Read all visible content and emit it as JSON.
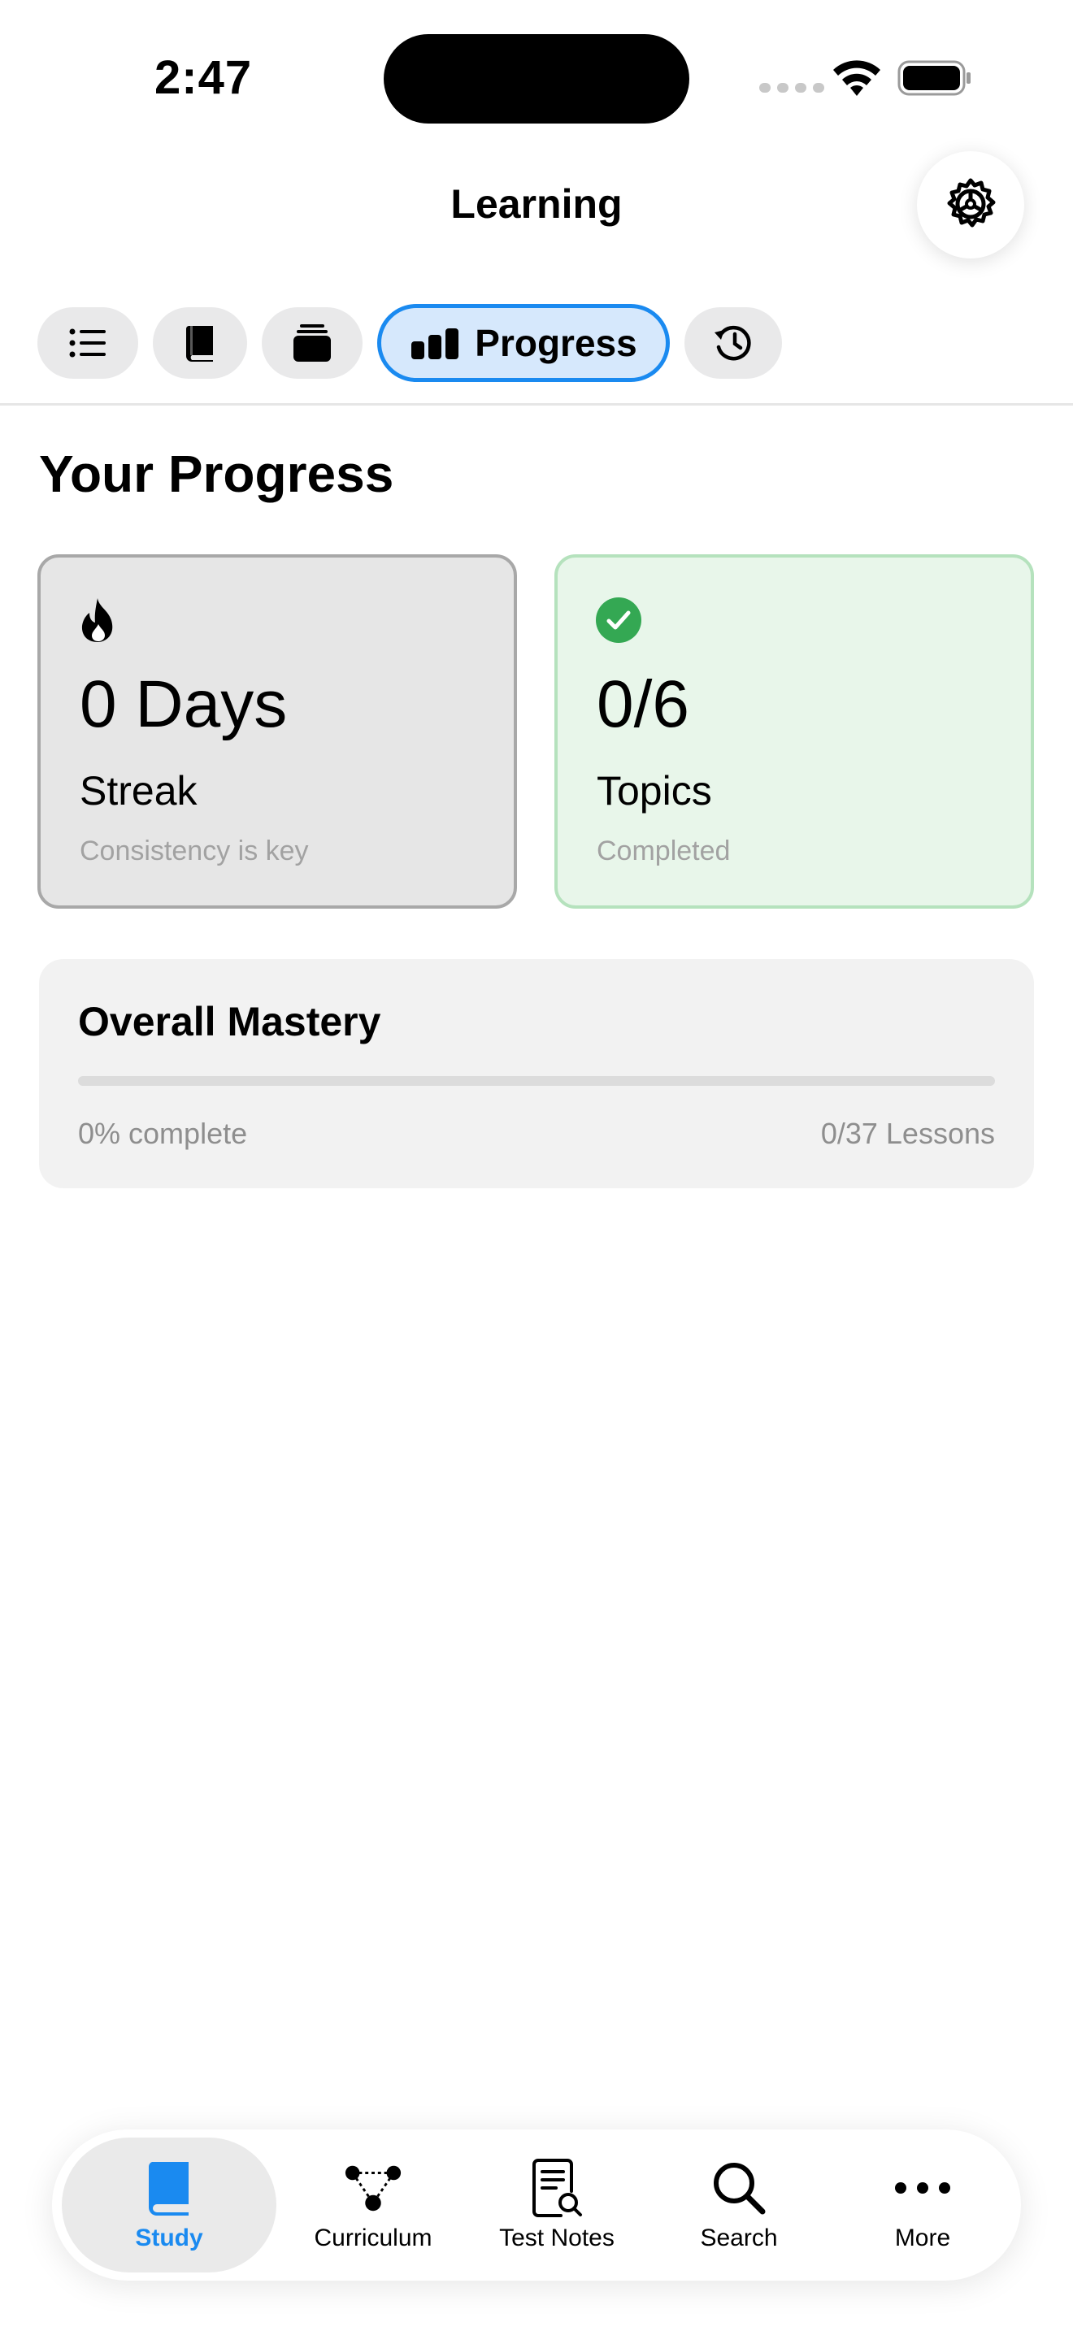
{
  "status_bar": {
    "time": "2:47"
  },
  "header": {
    "title": "Learning"
  },
  "tabs": [
    {
      "id": "list",
      "icon": "list-icon"
    },
    {
      "id": "book",
      "icon": "book-icon"
    },
    {
      "id": "stack",
      "icon": "stack-icon"
    },
    {
      "id": "progress",
      "icon": "bar-chart-icon",
      "label": "Progress",
      "selected": true
    },
    {
      "id": "history",
      "icon": "history-icon"
    }
  ],
  "section": {
    "title": "Your Progress"
  },
  "cards": {
    "streak": {
      "icon": "flame-icon",
      "value": "0 Days",
      "label": "Streak",
      "sub": "Consistency is key"
    },
    "topics": {
      "icon": "check-circle-icon",
      "value": "0/6",
      "label": "Topics",
      "sub": "Completed"
    }
  },
  "mastery": {
    "title": "Overall Mastery",
    "percent_text": "0% complete",
    "progress_fraction": 0,
    "lessons_text": "0/37 Lessons"
  },
  "tab_bar": {
    "items": [
      {
        "label": "Study",
        "icon": "book-icon",
        "selected": true
      },
      {
        "label": "Curriculum",
        "icon": "graph-nodes-icon"
      },
      {
        "label": "Test Notes",
        "icon": "document-search-icon"
      },
      {
        "label": "Search",
        "icon": "search-icon"
      },
      {
        "label": "More",
        "icon": "more-dots-icon"
      }
    ]
  },
  "colors": {
    "accent": "#1a8af0",
    "selected_tab_bg": "#d6e8fc",
    "topics_card_bg": "#e8f6ea",
    "check_green": "#34a853"
  }
}
